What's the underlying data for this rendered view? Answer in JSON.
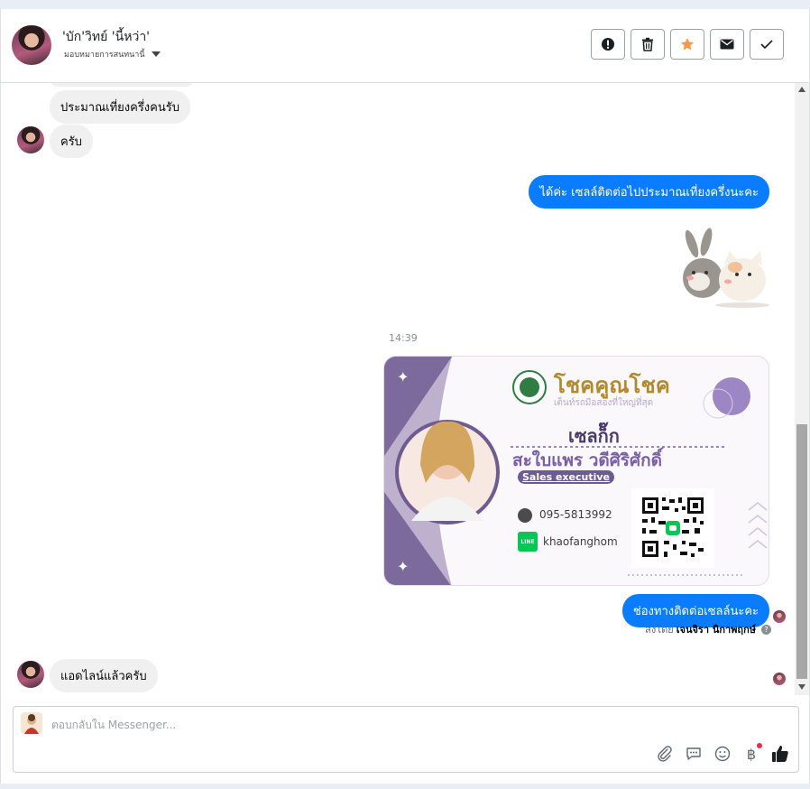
{
  "header": {
    "contact_name": "'บัก'วิทย์ 'นี้หว่า'",
    "assign_label": "มอบหมายการสนทนานี้"
  },
  "messages": {
    "in_1": "ประมาณเที่ยงครึ่งคนรับ",
    "in_2": "ครับ",
    "out_1": "ได้ค่ะ เซลล์ติดต่อไปประมาณเที่ยงครึ่งนะคะ",
    "timestamp": "14:39",
    "out_2": "ช่องทางติดต่อเซลล์นะคะ",
    "sent_by_prefix": "ส่งโดย",
    "sent_by_name": "เจนจิรา นิกาพฤกษ์",
    "in_3": "แอดไลน์แล้วครับ"
  },
  "card": {
    "brand": "โชคคูณโชค",
    "tagline": "เต็นท์รถมือสองที่ใหญ่ที่สุด",
    "nickname": "เซลก็๊ก",
    "fullname": "สะใบแพร วดีศิริศักดิ์",
    "role": "Sales executive",
    "phone": "095-5813992",
    "line_id": "khaofanghom",
    "line_badge": "LINE"
  },
  "composer": {
    "placeholder": "ตอบกลับใน Messenger..."
  },
  "icons": {
    "spam": "exclamation-icon",
    "delete": "trash-icon",
    "star": "star-icon",
    "mail": "mail-icon",
    "done": "check-icon"
  },
  "colors": {
    "outgoing_bubble": "#0a7cff",
    "incoming_bubble": "#f0f0f0",
    "star": "#f2994a",
    "like": "#1c1e21"
  }
}
